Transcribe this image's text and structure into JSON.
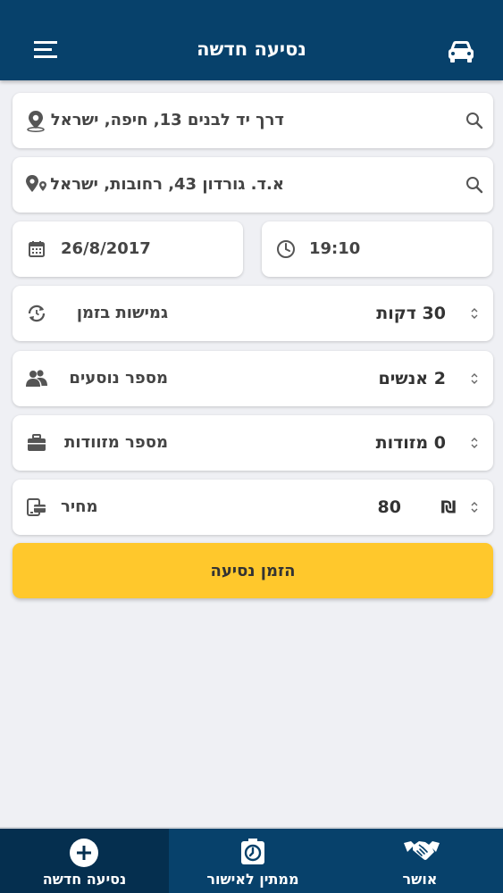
{
  "header": {
    "title": "נסיעה חדשה",
    "menu_icon": "menu-icon",
    "car_icon": "car-icon"
  },
  "form": {
    "origin": {
      "value": "דרך יד לבנים 13, חיפה, ישראל",
      "icon": "location-pin-icon",
      "search_icon": "search-icon"
    },
    "destination": {
      "value": "א.ד. גורדון 43, רחובות, ישראל",
      "icon": "route-pins-icon",
      "search_icon": "search-icon"
    },
    "date": {
      "value": "26/8/2017",
      "icon": "calendar-icon"
    },
    "time": {
      "value": "19:10",
      "icon": "clock-icon"
    },
    "flexibility": {
      "label": "גמישות בזמן",
      "value": "30 דקות",
      "icon": "refresh-clock-icon"
    },
    "passengers": {
      "label": "מספר נוסעים",
      "value": "2 אנשים",
      "icon": "people-icon"
    },
    "luggage": {
      "label": "מספר מזוודות",
      "value": "0 מזודות",
      "icon": "suitcase-icon"
    },
    "price": {
      "label": "מחיר",
      "value": "80",
      "currency": "₪",
      "icon": "payment-icon"
    }
  },
  "order_button": {
    "label": "הזמן נסיעה"
  },
  "bottom_nav": {
    "items": [
      {
        "label": "נסיעה חדשה",
        "icon": "plus-circle-icon",
        "active": true
      },
      {
        "label": "ממתין לאישור",
        "icon": "pending-clock-icon",
        "active": false
      },
      {
        "label": "אושר",
        "icon": "handshake-icon",
        "active": false
      }
    ]
  },
  "colors": {
    "header": "#07416b",
    "accent": "#ffc82c",
    "background": "#eff0f4",
    "nav_active": "#052f4f"
  }
}
